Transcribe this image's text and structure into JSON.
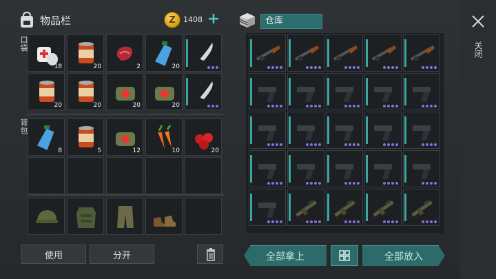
{
  "inventory": {
    "title": "物品栏",
    "coins": "1408",
    "pocket_label": "口袋",
    "backpack_label": "背包",
    "pocket_rows": [
      [
        {
          "icon": "bandage-icon",
          "qty": "18"
        },
        {
          "icon": "canned-food-icon",
          "qty": "20"
        },
        {
          "icon": "raw-meat-icon",
          "qty": "2"
        },
        {
          "icon": "water-bottle-icon",
          "qty": "20"
        },
        {
          "icon": "machete-icon",
          "qty": ""
        }
      ],
      [
        {
          "icon": "canned-food-icon",
          "qty": "20"
        },
        {
          "icon": "canned-food-icon",
          "qty": "20"
        },
        {
          "icon": "medkit-bag-icon",
          "qty": "20"
        },
        {
          "icon": "medkit-bag-icon",
          "qty": "20"
        },
        {
          "icon": "machete-icon",
          "qty": ""
        }
      ]
    ],
    "backpack_rows": [
      [
        {
          "icon": "water-bottle-icon",
          "qty": "8"
        },
        {
          "icon": "canned-food-icon",
          "qty": "5"
        },
        {
          "icon": "medkit-bag-icon",
          "qty": "12"
        },
        {
          "icon": "carrot-icon",
          "qty": "10"
        },
        {
          "icon": "berries-icon",
          "qty": "20"
        }
      ],
      [
        {
          "icon": "",
          "qty": ""
        },
        {
          "icon": "",
          "qty": ""
        },
        {
          "icon": "",
          "qty": ""
        },
        {
          "icon": "",
          "qty": ""
        },
        {
          "icon": "",
          "qty": ""
        }
      ]
    ],
    "equipment": [
      {
        "icon": "camo-cap-icon"
      },
      {
        "icon": "camo-vest-icon"
      },
      {
        "icon": "camo-pants-icon"
      },
      {
        "icon": "boots-icon"
      },
      {
        "icon": ""
      }
    ],
    "use_label": "使用",
    "split_label": "分开"
  },
  "storage": {
    "title": "仓库",
    "rows": [
      [
        "shotgun-icon",
        "shotgun-icon",
        "shotgun-icon",
        "shotgun-icon",
        "shotgun-icon"
      ],
      [
        "pistol-icon",
        "pistol-icon",
        "pistol-icon",
        "pistol-icon",
        "pistol-icon"
      ],
      [
        "pistol-icon",
        "pistol-icon",
        "pistol-icon",
        "pistol-icon",
        "pistol-icon"
      ],
      [
        "pistol-icon",
        "pistol-icon",
        "pistol-icon",
        "pistol-icon",
        "pistol-icon"
      ],
      [
        "pistol-icon",
        "rifle-icon",
        "rifle-icon",
        "rifle-icon",
        "rifle-icon"
      ]
    ],
    "take_all_label": "全部拿上",
    "put_all_label": "全部放入"
  },
  "close_label": "关闭",
  "colors": {
    "accent": "#2d6a6a",
    "dot": "#8a6fe0"
  }
}
